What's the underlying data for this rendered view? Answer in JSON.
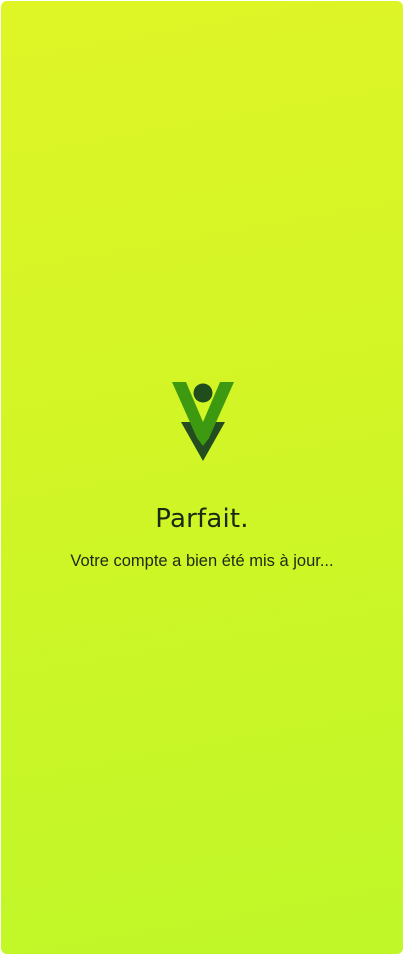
{
  "colors": {
    "background_top": "#dff526",
    "background_bottom": "#bff728",
    "logo_green": "#3f9b0f",
    "logo_dark": "#1f4d1c",
    "text": "#1a2a12"
  },
  "logo": {
    "icon": "brand-v-logo-icon"
  },
  "message": {
    "title": "Parfait.",
    "subtitle": "Votre compte a bien été mis à jour..."
  }
}
